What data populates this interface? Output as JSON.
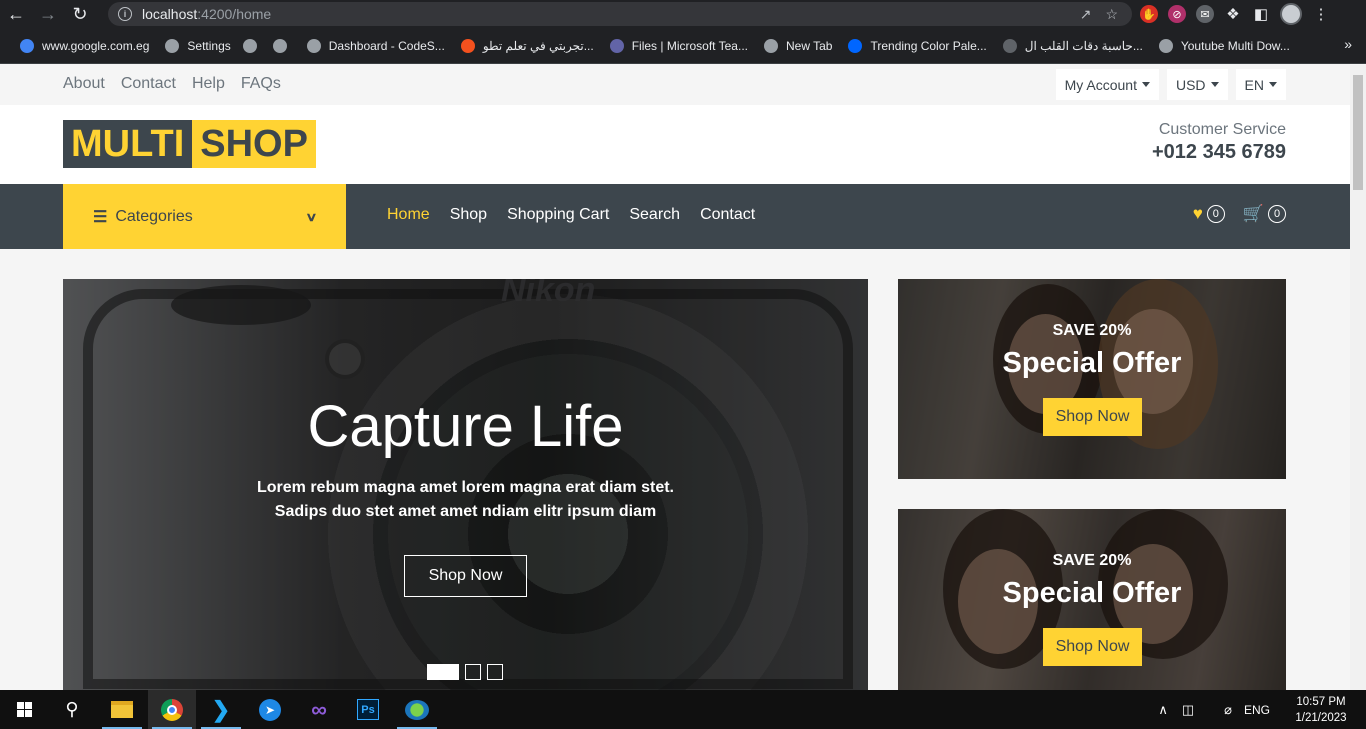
{
  "browser": {
    "url_host": "localhost",
    "url_path": ":4200/home",
    "bookmarks": [
      {
        "label": "www.google.com.eg",
        "icon": "google-icon",
        "color": "#4285f4"
      },
      {
        "label": "Settings",
        "icon": "gear-icon",
        "color": "#9aa0a6"
      },
      {
        "label": "",
        "icon": "globe-icon",
        "color": "#9aa0a6"
      },
      {
        "label": "",
        "icon": "globe-icon",
        "color": "#9aa0a6"
      },
      {
        "label": "Dashboard - CodeS...",
        "icon": "page-icon",
        "color": "#9aa0a6"
      },
      {
        "label": "تجربتي في تعلم تطو...",
        "icon": "blogger-icon",
        "color": "#f4511e"
      },
      {
        "label": "Files | Microsoft Tea...",
        "icon": "teams-icon",
        "color": "#6264a7"
      },
      {
        "label": "New Tab",
        "icon": "globe-icon",
        "color": "#9aa0a6"
      },
      {
        "label": "Trending Color Pale...",
        "icon": "coolors-icon",
        "color": "#0066ff"
      },
      {
        "label": "حاسبة دقات القلب ال...",
        "icon": "heart-icon",
        "color": "#5f6368"
      },
      {
        "label": "Youtube Multi Dow...",
        "icon": "globe-icon",
        "color": "#9aa0a6"
      }
    ],
    "more_label": "»"
  },
  "topbar": {
    "links": [
      "About",
      "Contact",
      "Help",
      "FAQs"
    ],
    "account_label": "My Account",
    "currency_label": "USD",
    "language_label": "EN"
  },
  "header": {
    "logo_part1": "MULTI",
    "logo_part2": "SHOP",
    "service_label": "Customer Service",
    "service_phone": "+012 345 6789"
  },
  "navbar": {
    "categories_label": "Categories",
    "links": [
      {
        "label": "Home",
        "active": true
      },
      {
        "label": "Shop",
        "active": false
      },
      {
        "label": "Shopping Cart",
        "active": false
      },
      {
        "label": "Search",
        "active": false
      },
      {
        "label": "Contact",
        "active": false
      }
    ],
    "wishlist_count": "0",
    "cart_count": "0"
  },
  "carousel": {
    "brand": "Nikon",
    "title": "Capture Life",
    "text": "Lorem rebum magna amet lorem magna erat diam stet. Sadips duo stet amet amet ndiam elitr ipsum diam",
    "button_label": "Shop Now",
    "slide_count": 3,
    "active_slide": 0
  },
  "offers": [
    {
      "save": "SAVE 20%",
      "title": "Special Offer",
      "button_label": "Shop Now"
    },
    {
      "save": "SAVE 20%",
      "title": "Special Offer",
      "button_label": "Shop Now"
    }
  ],
  "taskbar": {
    "time": "10:57 PM",
    "date": "1/21/2023",
    "language": "ENG"
  },
  "colors": {
    "accent": "#ffd333",
    "dark": "#3d464d"
  }
}
